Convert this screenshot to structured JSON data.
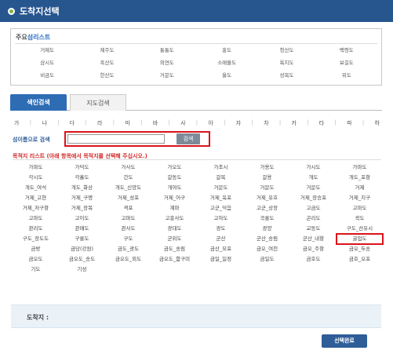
{
  "window": {
    "title": "도착지선택"
  },
  "island_list": {
    "title_main": "주요",
    "title_accent": "섬리스트",
    "items": [
      "거제도",
      "제주도",
      "통통도",
      "홍도",
      "청산도",
      "백령도",
      "삼시도",
      "흑산도",
      "외연도",
      "소매물도",
      "욕지도",
      "보길도",
      "비금도",
      "한산도",
      "거문도",
      "울도",
      "성목도",
      "위도"
    ]
  },
  "tabs": {
    "index_search": "색인검색",
    "map_search": "지도검색"
  },
  "consonants": [
    "가",
    "나",
    "다",
    "라",
    "마",
    "바",
    "사",
    "아",
    "자",
    "차",
    "카",
    "타",
    "파",
    "하"
  ],
  "search": {
    "label": "섬이름으로 검색",
    "value": "",
    "button": "검색"
  },
  "destination_list": {
    "title": "목적지 리스트 (아래 항목에서 목적지를 선택해 주십시오.)",
    "items": [
      "가파도",
      "가덕도",
      "가사도",
      "가오도",
      "가조시",
      "가용도",
      "가시도",
      "가마도",
      "각시도",
      "각흘도",
      "간도",
      "갈동도",
      "갈목",
      "갈용",
      "개도",
      "개도_포항",
      "개도_여석",
      "개도_화상",
      "개도_신양도",
      "개야도",
      "거문도",
      "거문도",
      "거문도",
      "거제",
      "거제_고현",
      "거제_구명",
      "거제_성포",
      "거제_어구",
      "거제_옥포",
      "거제_유호",
      "거제_장승포",
      "거제_지구",
      "거제_저구항",
      "거제_장목",
      "격포",
      "계마",
      "고군_덕음",
      "고군_상장",
      "고금도",
      "고마도",
      "고마도",
      "고이도",
      "고파도",
      "고흥사도",
      "고하도",
      "곡룡도",
      "곤리도",
      "곽도",
      "관리도",
      "관매도",
      "관사도",
      "광대도",
      "광도",
      "광양",
      "교동도",
      "구도_선유시",
      "구도_장도도",
      "구룡도",
      "구도",
      "군위도",
      "군산",
      "군산_송림",
      "군산_내항",
      "굴업도",
      "금방",
      "금당(강원)",
      "금도_광도",
      "금도_송림",
      "금산_모포",
      "금오_여천",
      "금오_주항",
      "금오_두송",
      "금오도",
      "금오도_송도",
      "금오도_외도",
      "금오도_함구미",
      "금일_일정",
      "금일도",
      "금호도",
      "금호_오포",
      "기도",
      "기성"
    ],
    "highlighted": "굴업도"
  },
  "arrival": {
    "label": "도착지 :"
  },
  "confirm": {
    "label": "선택완료"
  }
}
